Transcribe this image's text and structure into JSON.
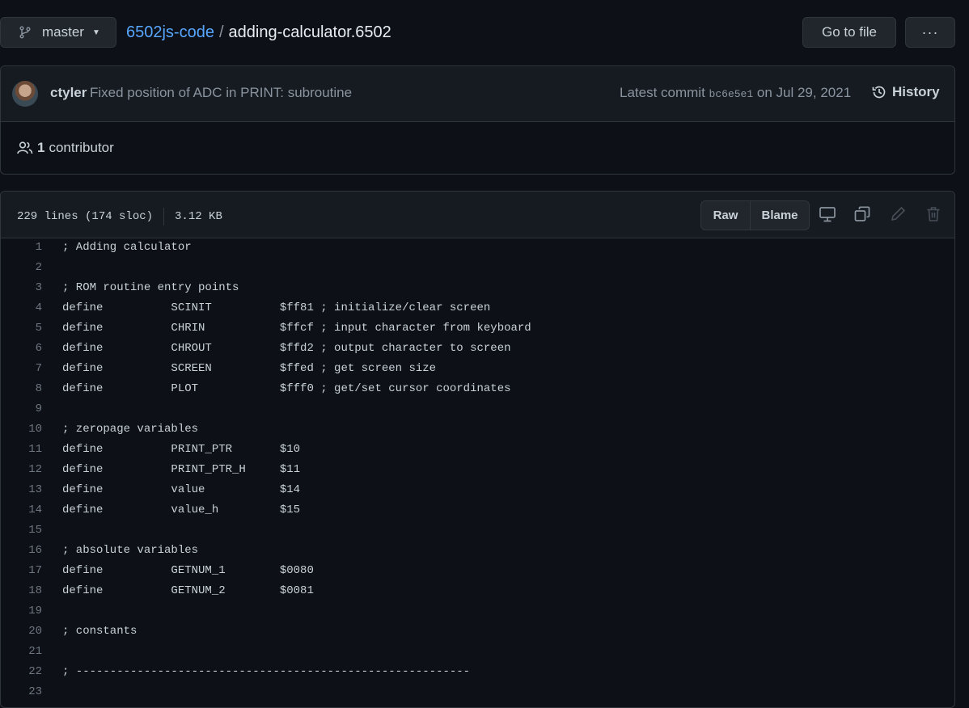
{
  "header": {
    "branch": "master",
    "repo": "6502js-code",
    "separator": "/",
    "file": "adding-calculator.6502",
    "go_to_file": "Go to file",
    "more": "···"
  },
  "commit": {
    "author": "ctyler",
    "message": "Fixed position of ADC in PRINT: subroutine",
    "latest_label": "Latest commit",
    "sha": "bc6e5e1",
    "date": "on Jul 29, 2021",
    "history": "History"
  },
  "contributors": {
    "count": "1",
    "label": "contributor"
  },
  "file_header": {
    "lines": "229 lines (174 sloc)",
    "size": "3.12 KB",
    "raw": "Raw",
    "blame": "Blame"
  },
  "icons": [
    "branch-icon",
    "caret-down-icon",
    "history-icon",
    "people-icon",
    "desktop-icon",
    "copy-icon",
    "pencil-icon",
    "trash-icon"
  ],
  "code": [
    {
      "n": "1",
      "t": "; Adding calculator"
    },
    {
      "n": "2",
      "t": ""
    },
    {
      "n": "3",
      "t": "; ROM routine entry points"
    },
    {
      "n": "4",
      "t": "define          SCINIT          $ff81 ; initialize/clear screen"
    },
    {
      "n": "5",
      "t": "define          CHRIN           $ffcf ; input character from keyboard"
    },
    {
      "n": "6",
      "t": "define          CHROUT          $ffd2 ; output character to screen"
    },
    {
      "n": "7",
      "t": "define          SCREEN          $ffed ; get screen size"
    },
    {
      "n": "8",
      "t": "define          PLOT            $fff0 ; get/set cursor coordinates"
    },
    {
      "n": "9",
      "t": ""
    },
    {
      "n": "10",
      "t": "; zeropage variables"
    },
    {
      "n": "11",
      "t": "define          PRINT_PTR       $10"
    },
    {
      "n": "12",
      "t": "define          PRINT_PTR_H     $11"
    },
    {
      "n": "13",
      "t": "define          value           $14"
    },
    {
      "n": "14",
      "t": "define          value_h         $15"
    },
    {
      "n": "15",
      "t": ""
    },
    {
      "n": "16",
      "t": "; absolute variables"
    },
    {
      "n": "17",
      "t": "define          GETNUM_1        $0080"
    },
    {
      "n": "18",
      "t": "define          GETNUM_2        $0081"
    },
    {
      "n": "19",
      "t": ""
    },
    {
      "n": "20",
      "t": "; constants"
    },
    {
      "n": "21",
      "t": ""
    },
    {
      "n": "22",
      "t": "; ----------------------------------------------------------"
    },
    {
      "n": "23",
      "t": ""
    }
  ]
}
